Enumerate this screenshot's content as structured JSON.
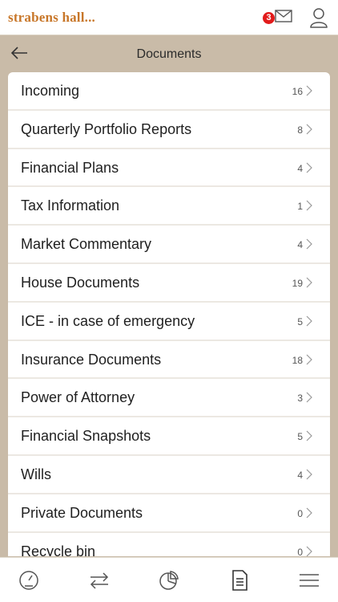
{
  "header": {
    "logo_text": "strabens hall...",
    "mail_badge": "3",
    "mail_icon": "mail-icon",
    "user_icon": "user-icon"
  },
  "subheader": {
    "title": "Documents",
    "back_icon": "arrow-left-icon"
  },
  "documents": [
    {
      "label": "Incoming",
      "count": "16"
    },
    {
      "label": "Quarterly Portfolio Reports",
      "count": "8"
    },
    {
      "label": "Financial Plans",
      "count": "4"
    },
    {
      "label": "Tax Information",
      "count": "1"
    },
    {
      "label": "Market Commentary",
      "count": "4"
    },
    {
      "label": "House Documents",
      "count": "19"
    },
    {
      "label": "ICE - in case of emergency",
      "count": "5"
    },
    {
      "label": "Insurance Documents",
      "count": "18"
    },
    {
      "label": "Power of Attorney",
      "count": "3"
    },
    {
      "label": "Financial Snapshots",
      "count": "5"
    },
    {
      "label": "Wills",
      "count": "4"
    },
    {
      "label": "Private Documents",
      "count": "0"
    },
    {
      "label": "Recycle bin",
      "count": "0"
    }
  ],
  "tabbar": {
    "items": [
      "dashboard-icon",
      "transfer-icon",
      "pie-chart-icon",
      "document-icon",
      "menu-icon"
    ]
  },
  "colors": {
    "brand": "#c8772a",
    "header_band": "#c9bba8",
    "badge": "#e21b1b"
  }
}
